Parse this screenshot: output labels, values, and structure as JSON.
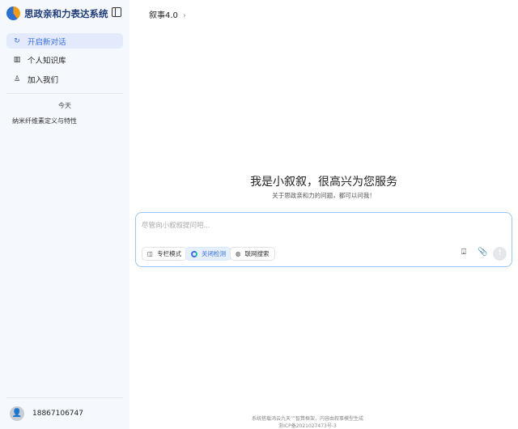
{
  "sidebar": {
    "brand": "思政亲和力表达系统",
    "items": [
      {
        "label": "开启新对话",
        "icon": "refresh-icon"
      },
      {
        "label": "个人知识库",
        "icon": "library-icon"
      },
      {
        "label": "加入我们",
        "icon": "user-add-icon"
      }
    ],
    "history_group": "今天",
    "history": [
      "纳米纤维素定义与特性"
    ],
    "user": "18867106747"
  },
  "header": {
    "model": "叙事4.0"
  },
  "welcome": {
    "title": "我是小叙叙，很高兴为您服务",
    "subtitle": "关于思政亲和力的问题，都可以问我！"
  },
  "input": {
    "placeholder": "尽管向小叙叙提问吧...",
    "chips": [
      "专栏模式",
      "关闭检测",
      "联网搜索"
    ]
  },
  "footer": {
    "line1": "系统搭载鸿云九天™智算框架，内容由叙事模型生成",
    "line2": "浙ICP备2021027473号-3"
  },
  "colors": {
    "accent": "#3a6ee8"
  }
}
